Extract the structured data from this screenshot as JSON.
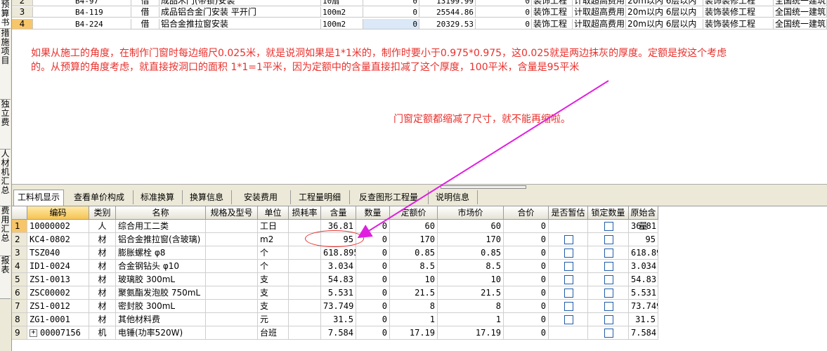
{
  "left_tabs": [
    "预算书",
    "措施项目",
    "独立费",
    "人材机汇总",
    "费用汇总",
    "报表"
  ],
  "top_table": {
    "rows": [
      {
        "rownum": "2",
        "code": "B4-97",
        "type": "借",
        "name": "成品木门(带锁)安装",
        "unit": "10扇",
        "qty": "0",
        "price": "13199.99",
        "total": "0",
        "prof": "装饰工程",
        "fee": "计取超高费用",
        "height": "20m以内 6层以内",
        "spec": "装饰装修工程",
        "std": "全国统一建筑"
      },
      {
        "rownum": "3",
        "code": "B4-119",
        "type": "借",
        "name": "成品铝合金门安装 平开门",
        "unit": "100m2",
        "qty": "0",
        "price": "25544.86",
        "total": "0",
        "prof": "装饰工程",
        "fee": "计取超高费用",
        "height": "20m以内 6层以内",
        "spec": "装饰装修工程",
        "std": "全国统一建筑"
      },
      {
        "rownum": "4",
        "code": "B4-224",
        "type": "借",
        "name": "铝合金推拉窗安装",
        "unit": "100m2",
        "qty": "0",
        "price": "20329.53",
        "total": "0",
        "prof": "装饰工程",
        "fee": "计取超高费用",
        "height": "20m以内 6层以内",
        "spec": "装饰装修工程",
        "std": "全国统一建筑"
      }
    ]
  },
  "annotation": {
    "line1": "如果从施工的角度，在制作门窗时每边缩尺0.025米，就是说洞如果是1*1米的，制作时要小于0.975*0.975，这0.025就是两边抹灰的厚度。定额是按这个考虑",
    "line2": "的。从预算的角度考虑，就直接按洞口的面积 1*1=1平米，因为定额中的含量直接扣减了这个厚度，100平米，含量是95平米",
    "line3": "门窗定额都缩减了尺寸，就不能再缩啦。"
  },
  "tabs": [
    "工料机显示",
    "查看单价构成",
    "标准换算",
    "换算信息",
    "安装费用",
    "工程量明细",
    "反查图形工程量",
    "说明信息"
  ],
  "grid": {
    "headers": [
      "编码",
      "类别",
      "名称",
      "规格及型号",
      "单位",
      "损耗率",
      "含量",
      "数量",
      "定额价",
      "市场价",
      "合价",
      "是否暂估",
      "锁定数量",
      "原始含量"
    ],
    "rows": [
      {
        "rn": "1",
        "code": "10000002",
        "cat": "人",
        "name": "综合用工二类",
        "unit": "工日",
        "content": "36.81",
        "qty": "0",
        "quota": "60",
        "market": "60",
        "total": "0",
        "est": false,
        "lock": true,
        "orig": "36.81"
      },
      {
        "rn": "2",
        "code": "KC4-0802",
        "cat": "材",
        "name": "铝合金推拉窗(含玻璃)",
        "unit": "m2",
        "content": "95",
        "qty": "0",
        "quota": "170",
        "market": "170",
        "total": "0",
        "est": true,
        "lock": true,
        "orig": "95"
      },
      {
        "rn": "3",
        "code": "TSZ040",
        "cat": "材",
        "name": "膨胀螺栓 φ8",
        "unit": "个",
        "content": "618.895",
        "qty": "0",
        "quota": "0.85",
        "market": "0.85",
        "total": "0",
        "est": true,
        "lock": true,
        "orig": "618.895"
      },
      {
        "rn": "4",
        "code": "ID1-0024",
        "cat": "材",
        "name": "合金钢钻头 φ10",
        "unit": "个",
        "content": "3.034",
        "qty": "0",
        "quota": "8.5",
        "market": "8.5",
        "total": "0",
        "est": true,
        "lock": true,
        "orig": "3.034"
      },
      {
        "rn": "5",
        "code": "ZS1-0013",
        "cat": "材",
        "name": "玻璃胶 300mL",
        "unit": "支",
        "content": "54.83",
        "qty": "0",
        "quota": "10",
        "market": "10",
        "total": "0",
        "est": true,
        "lock": true,
        "orig": "54.83"
      },
      {
        "rn": "6",
        "code": "ZSC00002",
        "cat": "材",
        "name": "聚氨酯发泡胶 750mL",
        "unit": "支",
        "content": "5.531",
        "qty": "0",
        "quota": "21.5",
        "market": "21.5",
        "total": "0",
        "est": true,
        "lock": true,
        "orig": "5.531"
      },
      {
        "rn": "7",
        "code": "ZS1-0012",
        "cat": "材",
        "name": "密封胶 300mL",
        "unit": "支",
        "content": "73.749",
        "qty": "0",
        "quota": "8",
        "market": "8",
        "total": "0",
        "est": true,
        "lock": true,
        "orig": "73.749"
      },
      {
        "rn": "8",
        "code": "ZG1-0001",
        "cat": "材",
        "name": "其他材料费",
        "unit": "元",
        "content": "31.5",
        "qty": "0",
        "quota": "1",
        "market": "1",
        "total": "0",
        "est": true,
        "lock": true,
        "orig": "31.5"
      },
      {
        "rn": "9",
        "code": "00007156",
        "cat": "机",
        "name": "电锤(功率520W)",
        "unit": "台班",
        "content": "7.584",
        "qty": "0",
        "quota": "17.19",
        "market": "17.19",
        "total": "0",
        "est": false,
        "lock": true,
        "orig": "7.584",
        "expand": "+"
      }
    ]
  },
  "colors": {
    "annotation": "#e8302c",
    "arrow": "#e020e0",
    "selected_row": "#f7c66b"
  }
}
